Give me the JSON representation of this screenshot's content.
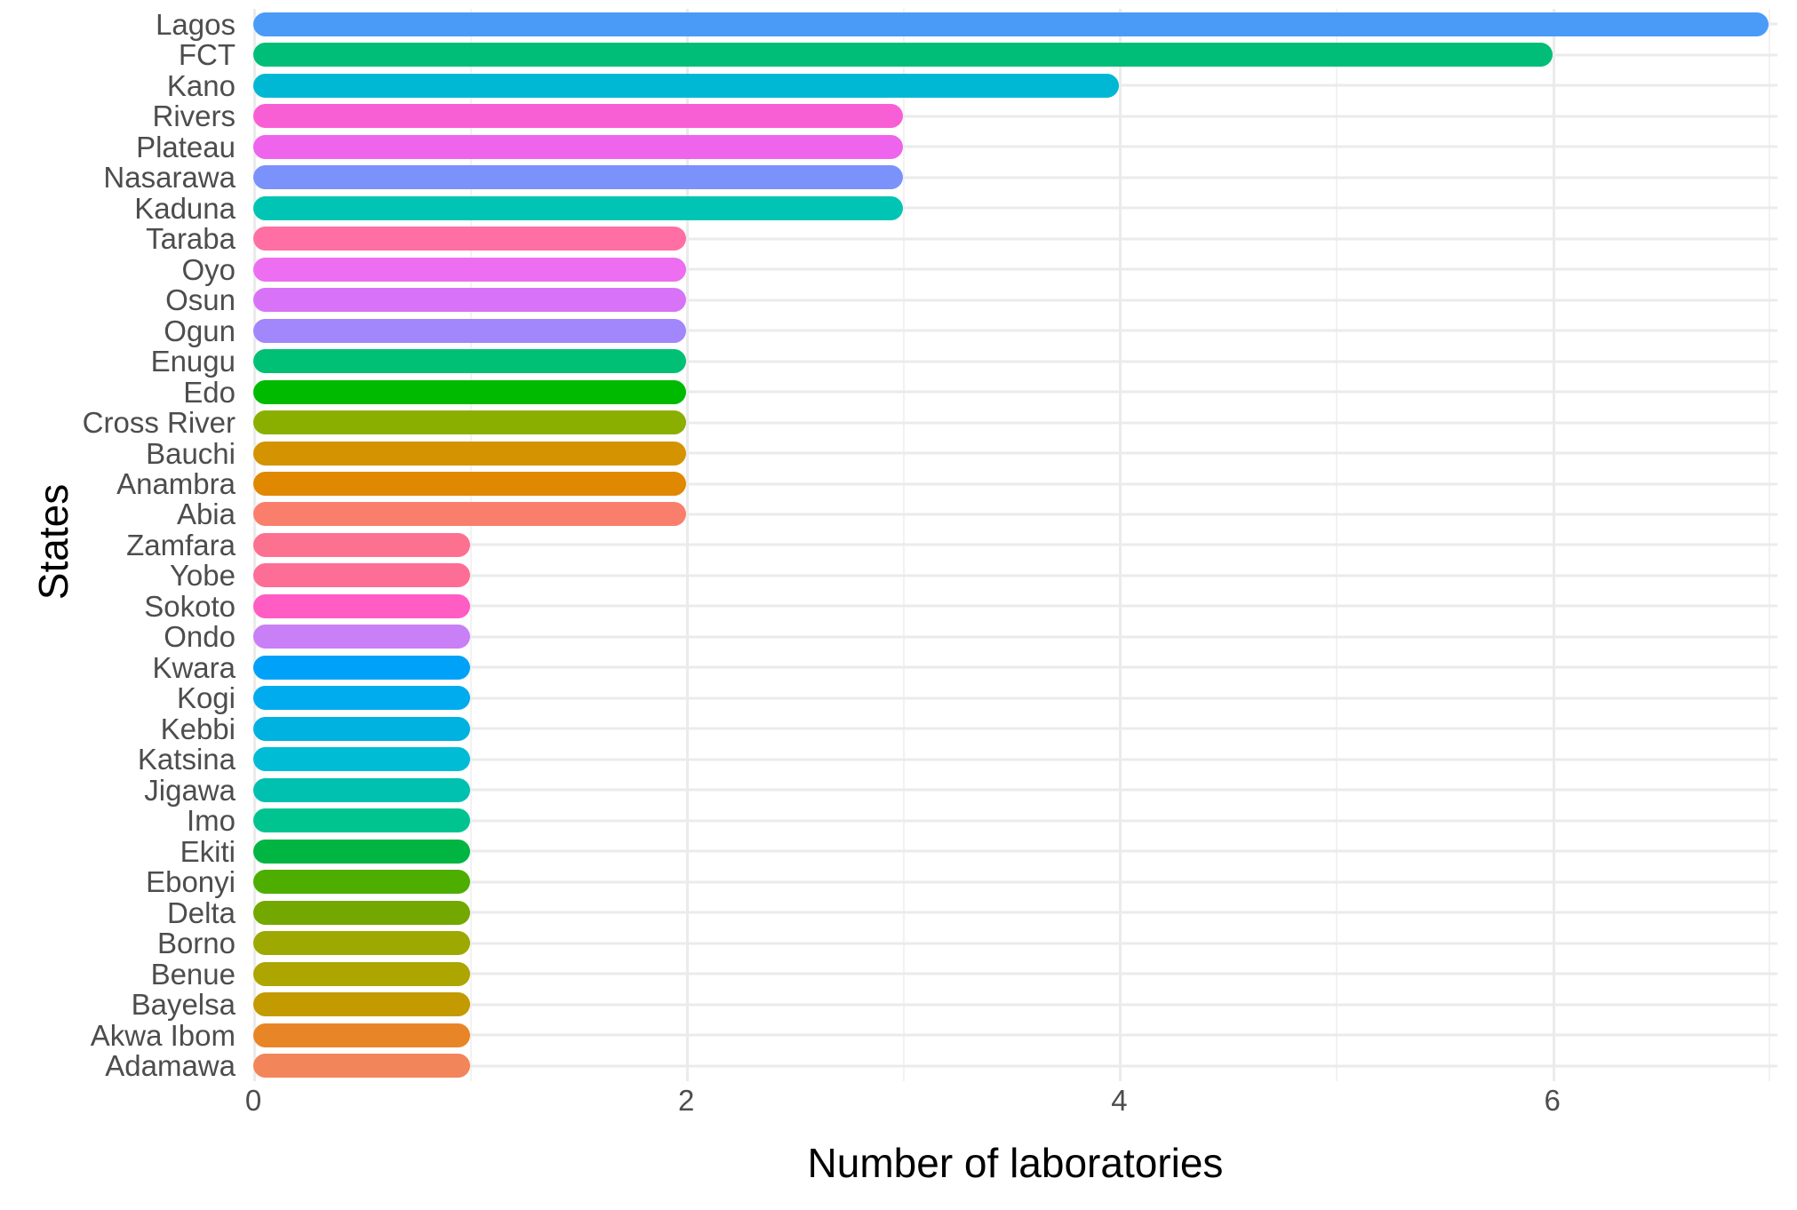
{
  "chart_data": {
    "type": "bar",
    "orientation": "horizontal",
    "title": "",
    "xlabel": "Number of laboratories",
    "ylabel": "States",
    "xlim": [
      0,
      7.04
    ],
    "ylim": null,
    "grid": true,
    "legend": false,
    "x_ticks": [
      0,
      2,
      4,
      6
    ],
    "x_tick_labels": [
      "0",
      "2",
      "4",
      "6"
    ],
    "x_minor_ticks": [
      1,
      3,
      5,
      7
    ],
    "categories": [
      "Lagos",
      "FCT",
      "Kano",
      "Rivers",
      "Plateau",
      "Nasarawa",
      "Kaduna",
      "Taraba",
      "Oyo",
      "Osun",
      "Ogun",
      "Enugu",
      "Edo",
      "Cross River",
      "Bauchi",
      "Anambra",
      "Abia",
      "Zamfara",
      "Yobe",
      "Sokoto",
      "Ondo",
      "Kwara",
      "Kogi",
      "Kebbi",
      "Katsina",
      "Jigawa",
      "Imo",
      "Ekiti",
      "Ebonyi",
      "Delta",
      "Borno",
      "Benue",
      "Bayelsa",
      "Akwa Ibom",
      "Adamawa"
    ],
    "values": [
      7,
      6,
      4,
      3,
      3,
      3,
      3,
      2,
      2,
      2,
      2,
      2,
      2,
      2,
      2,
      2,
      2,
      1,
      1,
      1,
      1,
      1,
      1,
      1,
      1,
      1,
      1,
      1,
      1,
      1,
      1,
      1,
      1,
      1,
      1
    ],
    "bar_colors": [
      "#4A9BF8",
      "#00BE78",
      "#00B8D4",
      "#F95FD4",
      "#EF64EC",
      "#7C92FB",
      "#00C4B4",
      "#FF6FA3",
      "#ED6EF0",
      "#D873F8",
      "#A186FC",
      "#00C075",
      "#00BA00",
      "#8BAF00",
      "#D49300",
      "#E08800",
      "#F97F6C",
      "#FC7190",
      "#FC6E95",
      "#FF5CC4",
      "#C97FF5",
      "#00A2F8",
      "#00ABEE",
      "#00B2E0",
      "#00BCD4",
      "#00C0B0",
      "#00C490",
      "#00B542",
      "#4DAE00",
      "#72A800",
      "#9DA800",
      "#ADA500",
      "#C39A00",
      "#E88627",
      "#F2855A"
    ],
    "panel_background": "#FFFFFF",
    "grid_color": "#EBEBEB",
    "axis_text_color": "#4D4D4D",
    "axis_title_color": "#000000"
  }
}
